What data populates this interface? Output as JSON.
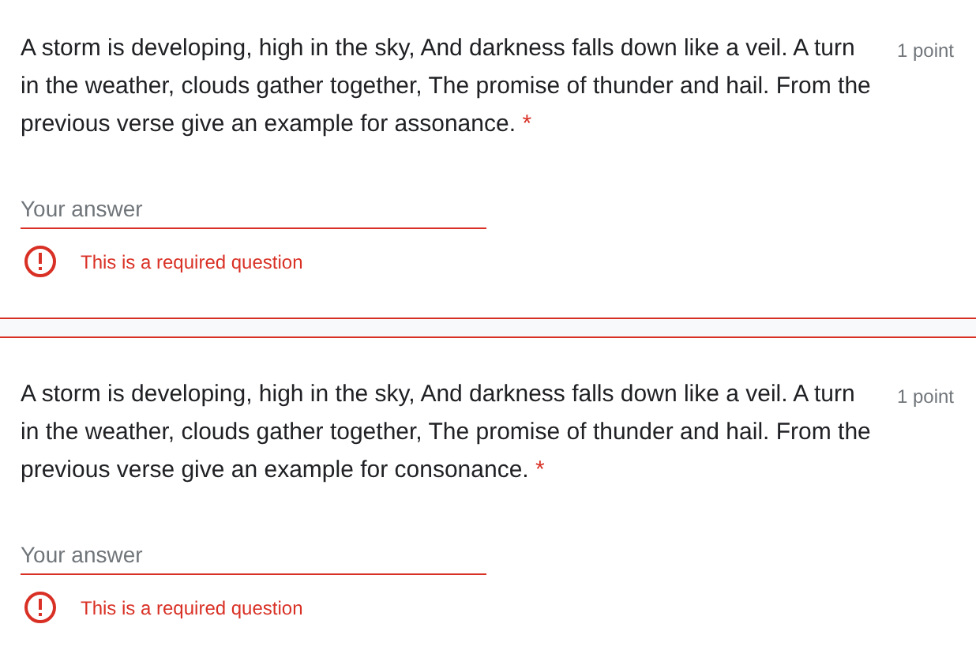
{
  "questions": [
    {
      "text": "A storm is developing, high in the sky, And darkness falls down like a veil. A turn in the weather, clouds gather together, The promise of thunder and hail. From the previous verse give an example for assonance.",
      "required_mark": "*",
      "points": "1 point",
      "placeholder": "Your answer",
      "error": "This is a required question"
    },
    {
      "text": "A storm is developing, high in the sky, And darkness falls down like a veil. A turn in the weather, clouds gather together, The promise of thunder and hail. From the previous verse give an example for consonance.",
      "required_mark": "*",
      "points": "1 point",
      "placeholder": "Your answer",
      "error": "This is a required question"
    }
  ]
}
